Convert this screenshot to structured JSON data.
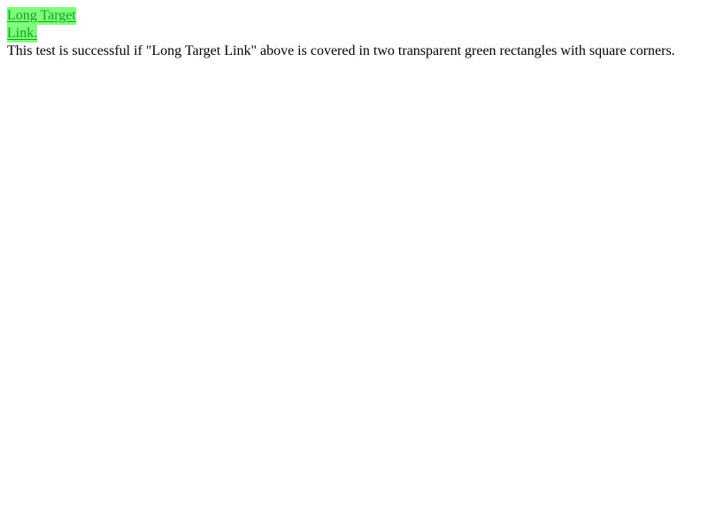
{
  "link": {
    "line1": "Long Target",
    "line2": "Link."
  },
  "description": "This test is successful if \"Long Target Link\" above is covered in two transparent green rectangles with square corners.",
  "colors": {
    "highlight": "#7dfc7d",
    "link_text": "#12a512",
    "background": "#ffffff",
    "text": "#000000"
  }
}
